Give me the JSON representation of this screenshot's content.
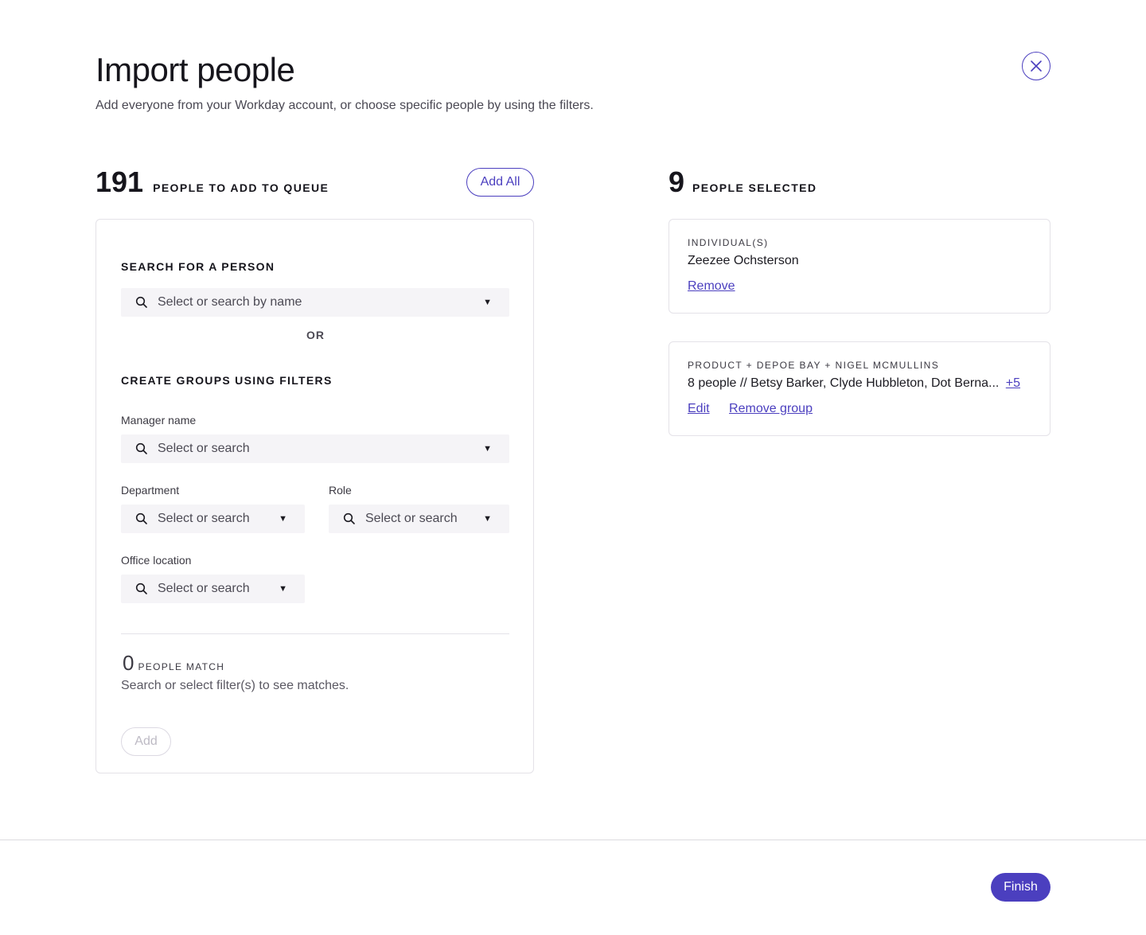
{
  "header": {
    "title": "Import people",
    "subtitle": "Add everyone from your Workday account, or choose specific people by using the filters."
  },
  "queue": {
    "count": "191",
    "label": "PEOPLE TO ADD TO QUEUE",
    "add_all_label": "Add All",
    "search_heading": "SEARCH FOR A PERSON",
    "search_placeholder": "Select or search by name",
    "or_label": "OR",
    "filters_heading": "CREATE GROUPS USING FILTERS",
    "manager": {
      "label": "Manager name",
      "placeholder": "Select or search"
    },
    "department": {
      "label": "Department",
      "placeholder": "Select or search"
    },
    "role": {
      "label": "Role",
      "placeholder": "Select or search"
    },
    "office": {
      "label": "Office location",
      "placeholder": "Select or search"
    },
    "match_count": "0",
    "match_label": "PEOPLE MATCH",
    "match_hint": "Search or select filter(s) to see matches.",
    "add_label": "Add"
  },
  "selected": {
    "count": "9",
    "label": "PEOPLE SELECTED",
    "individual_card": {
      "tag": "INDIVIDUAL(S)",
      "name": "Zeezee Ochsterson",
      "remove_label": "Remove"
    },
    "group_card": {
      "tag": "PRODUCT + DEPOE BAY + NIGEL MCMULLINS",
      "summary": "8 people // Betsy Barker, Clyde Hubbleton, Dot Berna...",
      "more_label": "+5",
      "edit_label": "Edit",
      "remove_group_label": "Remove group"
    }
  },
  "footer": {
    "finish_label": "Finish"
  },
  "colors": {
    "accent": "#4b3fbf",
    "field_bg": "#f5f4f7",
    "border": "#e4e2e8"
  }
}
